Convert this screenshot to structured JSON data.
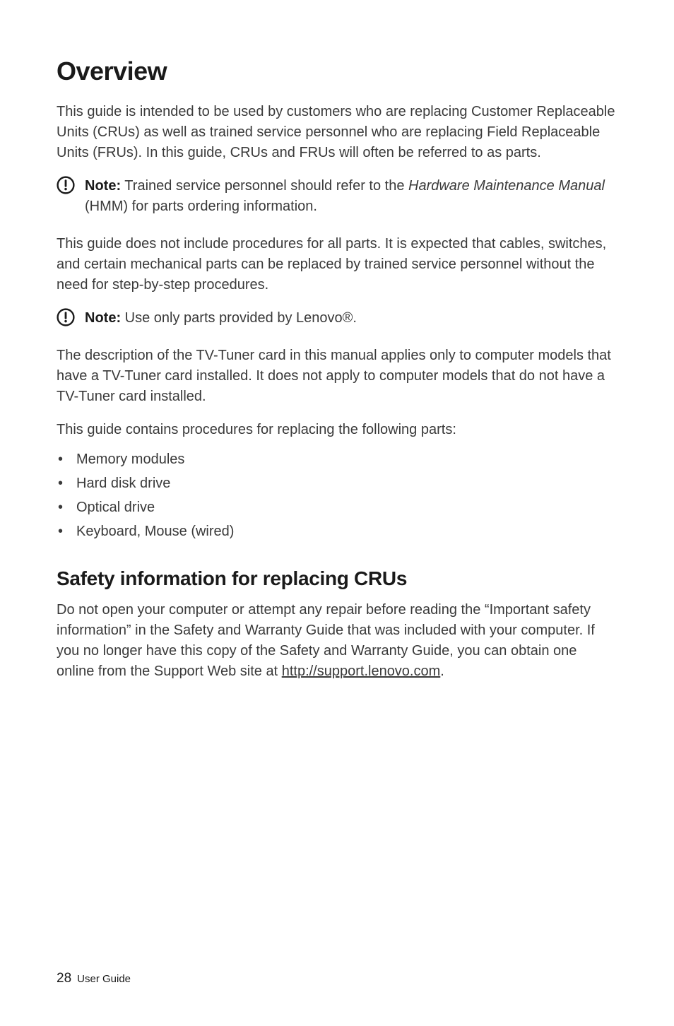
{
  "heading": "Overview",
  "intro": "This guide is intended to be used by customers who are replacing Customer Replaceable Units (CRUs) as well as trained service personnel who are replacing Field Replaceable Units (FRUs). In this guide, CRUs and FRUs will often be referred to as parts.",
  "note1": {
    "label": "Note:",
    "pre": " Trained service personnel should refer to the ",
    "italic": "Hardware Maintenance Manual",
    "post": " (HMM) for parts ordering information."
  },
  "para2": "This guide does not include procedures for all parts. It is expected that cables, switches, and certain mechanical parts can be replaced by trained service personnel without the need for step-by-step procedures.",
  "note2": {
    "label": "Note:",
    "text": " Use only parts provided by Lenovo®."
  },
  "para3": "The description of the TV-Tuner card in this manual applies only to computer models that have a TV-Tuner card installed. It does not apply to computer models that do not have a TV-Tuner card installed.",
  "para4": "This guide contains procedures for replacing the following parts:",
  "parts": [
    "Memory modules",
    "Hard disk drive",
    "Optical drive",
    "Keyboard, Mouse (wired)"
  ],
  "subheading": "Safety information for replacing CRUs",
  "safety": {
    "pre": "Do not open your computer or attempt any repair before reading the “Important safety information” in the Safety and Warranty Guide that was included with your computer. If you no longer have this copy of the Safety and Warranty Guide, you can obtain one online from the Support Web site at ",
    "link": "http://support.lenovo.com",
    "post": "."
  },
  "footer": {
    "page": "28",
    "title": "User Guide"
  }
}
